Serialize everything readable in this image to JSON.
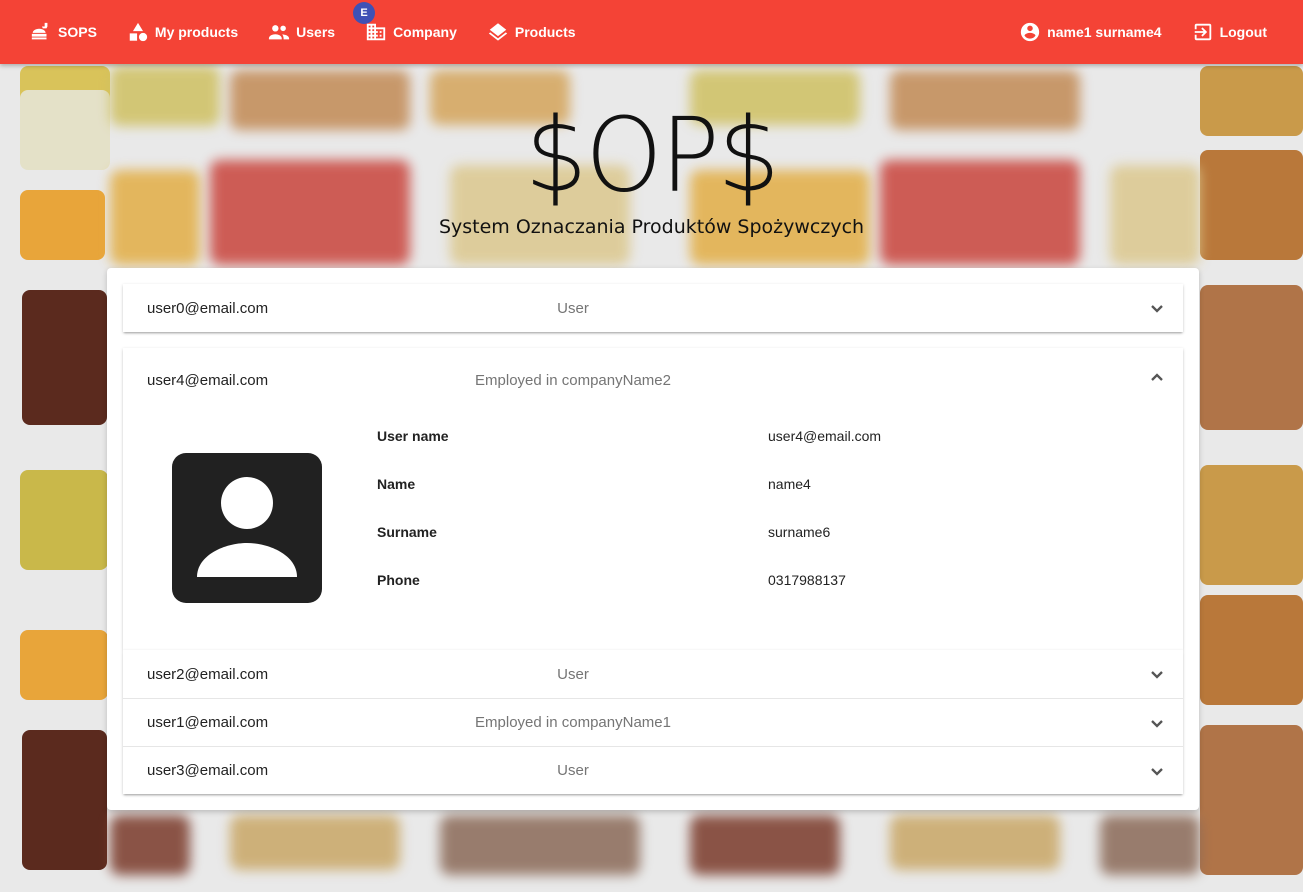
{
  "nav": {
    "brand": "SOPS",
    "my_products": "My products",
    "users": "Users",
    "company": "Company",
    "company_badge": "E",
    "products": "Products",
    "user_name": "name1 surname4",
    "logout": "Logout"
  },
  "hero": {
    "logo": "$OP$",
    "subtitle": "System Oznaczania Produktów Spożywczych"
  },
  "users": [
    {
      "email": "user0@email.com",
      "role": "User"
    },
    {
      "email": "user4@email.com",
      "role": "Employed in companyName2"
    },
    {
      "email": "user2@email.com",
      "role": "User"
    },
    {
      "email": "user1@email.com",
      "role": "Employed in companyName1"
    },
    {
      "email": "user3@email.com",
      "role": "User"
    }
  ],
  "detail": {
    "labels": {
      "username": "User name",
      "name": "Name",
      "surname": "Surname",
      "phone": "Phone"
    },
    "values": {
      "username": "user4@email.com",
      "name": "name4",
      "surname": "surname6",
      "phone": "0317988137"
    }
  },
  "colors": {
    "primary": "#f44336",
    "badge": "#3f51b5"
  }
}
